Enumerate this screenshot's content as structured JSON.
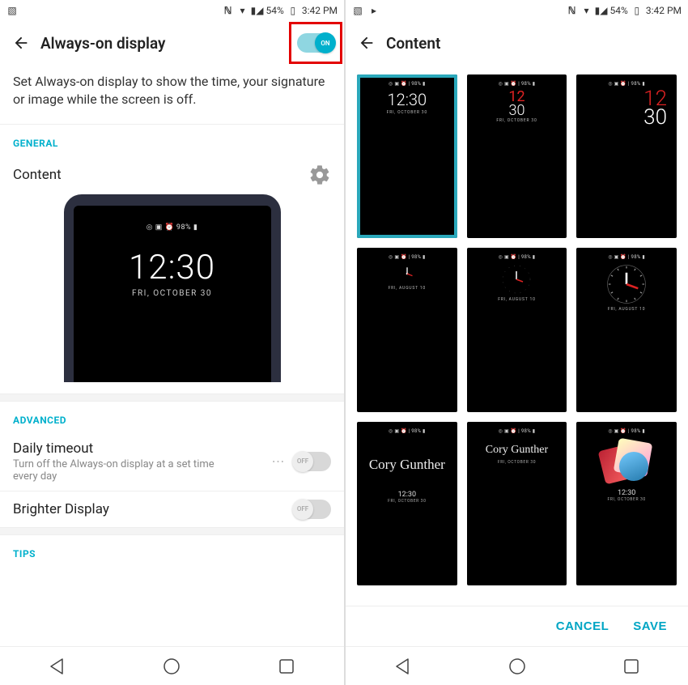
{
  "statusbar": {
    "battery": "54%",
    "time": "3:42 PM"
  },
  "screen1": {
    "title": "Always-on display",
    "toggle_on_label": "ON",
    "description": "Set Always-on display to show the time, your signature or image while the screen is off.",
    "sections": {
      "general": "GENERAL",
      "advanced": "ADVANCED",
      "tips": "TIPS"
    },
    "content_label": "Content",
    "preview": {
      "status": "◎ ▣ ⏰  98% ▮",
      "time": "12:30",
      "date": "FRI, OCTOBER 30"
    },
    "daily_timeout": {
      "title": "Daily timeout",
      "sub": "Turn off the Always-on display at a set time every day",
      "toggle_label": "OFF"
    },
    "brighter": {
      "title": "Brighter Display",
      "toggle_label": "OFF"
    }
  },
  "screen2": {
    "title": "Content",
    "thumb_status": "◎ ▣ ⏰ | 98% ▮",
    "thumbs": [
      {
        "kind": "digital",
        "time": "12:30",
        "date": "FRI, OCTOBER 30",
        "selected": true
      },
      {
        "kind": "stacked",
        "hour": "12",
        "min": "30",
        "date": "FRI, OCTOBER 30"
      },
      {
        "kind": "large",
        "hour": "12",
        "min": "30"
      },
      {
        "kind": "analog_minimal",
        "date": "FRI, AUGUST 10"
      },
      {
        "kind": "analog_dots",
        "date": "FRI, AUGUST 10"
      },
      {
        "kind": "analog_full",
        "date": "FRI, AUGUST 10"
      },
      {
        "kind": "signature_below",
        "name": "Cory Gunther",
        "time": "12:30",
        "date": "FRI, OCTOBER 30"
      },
      {
        "kind": "signature_above",
        "name": "Cory Gunther",
        "date": "FRI, OCTOBER 30"
      },
      {
        "kind": "photo",
        "time": "12:30",
        "date": "FRI, OCTOBER 30"
      }
    ],
    "actions": {
      "cancel": "CANCEL",
      "save": "SAVE"
    }
  }
}
